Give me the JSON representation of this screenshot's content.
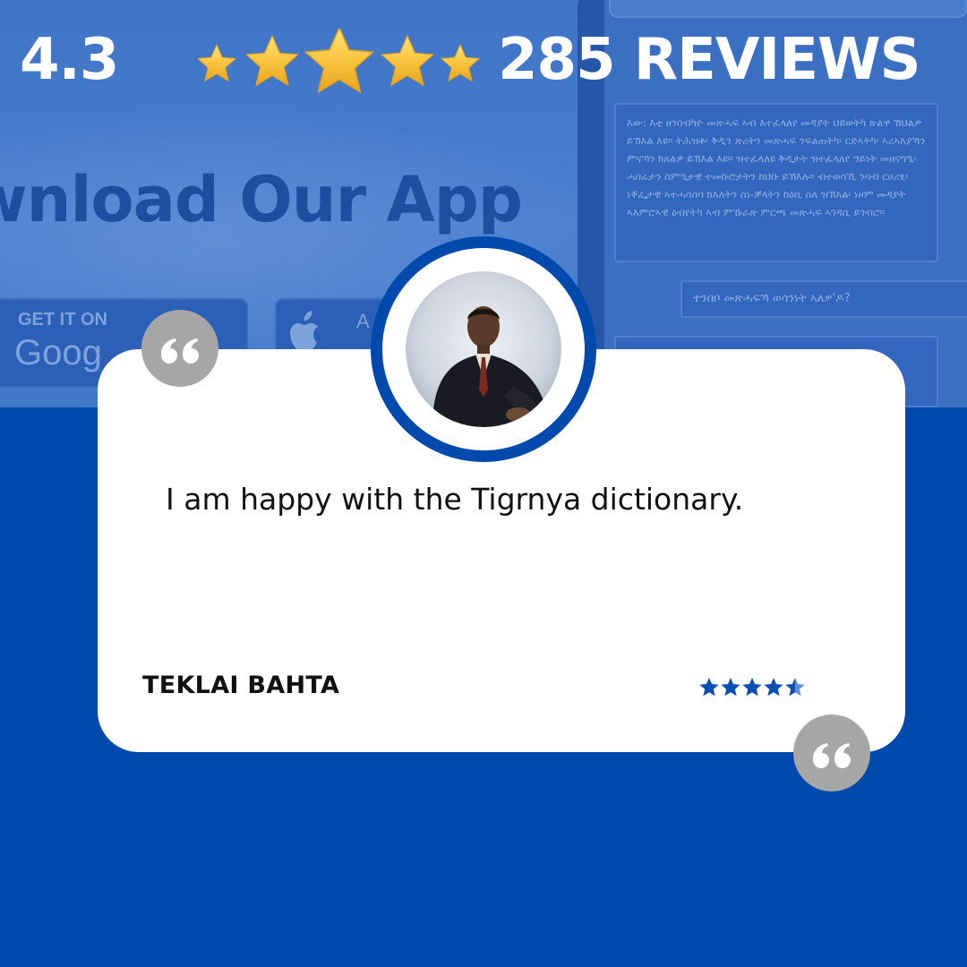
{
  "header": {
    "rating_value": "4.3",
    "rating_fraction": 0.86,
    "reviews_label": "285 REVIEWS"
  },
  "background": {
    "headline": "wnload Our App",
    "store_google_small": "GET IT ON",
    "store_google_big": "Goog",
    "store_apple_text": "A",
    "tigrinya_paragraph": "እው: እቲ ዘንበብካዮ መጽሓፍ ኣብ እተፈላለየ መዳያት ህይወትካ ጽልዋ ኽህልዎ ይኽእል እዩ። ትሕዝቶ፡ ቅዲን ጽሪትን መጽሓፍ ንፍልጠትካ፡ ርድኣትካ፡ ኣረኣእያኻን ምናኻን ክጸልዎ ይኽእል እዩ። ዝተፈላለዩ ቅዲታት ዝተፈላለየ ዓይነት መዘናግዒ፡ ሓበሬታን ስምዒታዊ ተመኩሮታትን ክህቡ ይኽእሉ። ብተወሳኺ ንባብ ርሀሪፂ፡ ነቐፌታዊ ኣተሓሳስባ ክእለትን ስነ-ቓላትን ከዕቢ ስለ ዝኽእል፡ ነዞም መዳያት ኣእምሮኣዊ ዕብየትካ ኣብ ምኹራጽ ምርጫ መጽሓፍ ኣገዳሲ ይገብሮ።",
    "tigrinya_question": "ተንበቦ መጽሓፍኻ ወሳንነት ኣለዎ'ዶ?"
  },
  "review": {
    "text": "I am happy with the Tigrnya dictionary.",
    "reviewer": "TEKLAI BAHTA",
    "star_rating": 4.5,
    "avatar_alt": "reviewer-photo"
  },
  "colors": {
    "brand_blue": "#004aad",
    "star_gold": "#f7c23b",
    "card_star_blue": "#0b4fb5",
    "quote_gray": "#a6a6a6"
  }
}
